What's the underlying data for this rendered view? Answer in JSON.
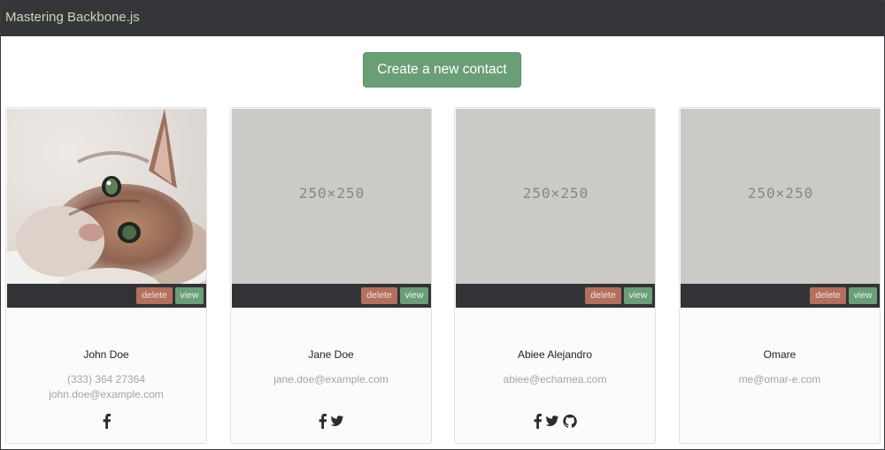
{
  "app": {
    "brand": "Mastering Backbone.js"
  },
  "toolbar": {
    "create_label": "Create a new contact"
  },
  "placeholder_label": "250×250",
  "colors": {
    "navbar": "#35363a",
    "create": "#6a9e77",
    "delete": "#b2705e",
    "view": "#6a9e77"
  },
  "contacts": [
    {
      "name": "John Doe",
      "line1": "(333) 364 27364",
      "line2": "john.doe@example.com",
      "delete_label": "delete",
      "view_label": "view",
      "avatar": "kitten-photo",
      "social": [
        "facebook-icon"
      ]
    },
    {
      "name": "Jane Doe",
      "line1": "jane.doe@example.com",
      "line2": "",
      "delete_label": "delete",
      "view_label": "view",
      "avatar": "placeholder",
      "social": [
        "facebook-icon",
        "twitter-icon"
      ]
    },
    {
      "name": "Abiee Alejandro",
      "line1": "abiee@echamea.com",
      "line2": "",
      "delete_label": "delete",
      "view_label": "view",
      "avatar": "placeholder",
      "social": [
        "facebook-icon",
        "twitter-icon",
        "github-icon"
      ]
    },
    {
      "name": "Omare",
      "line1": "me@omar-e.com",
      "line2": "",
      "delete_label": "delete",
      "view_label": "view",
      "avatar": "placeholder",
      "social": []
    }
  ]
}
